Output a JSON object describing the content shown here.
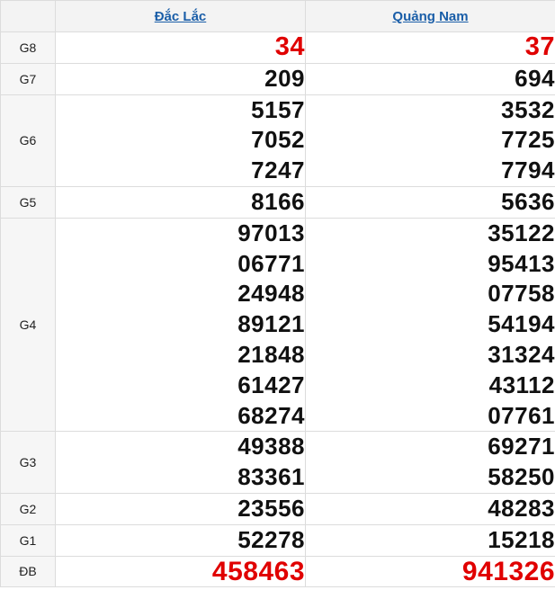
{
  "header": {
    "provinces": [
      "Đắc Lắc",
      "Quảng Nam"
    ]
  },
  "prizes": [
    {
      "label": "G8",
      "style": "red",
      "values": [
        [
          "34"
        ],
        [
          "37"
        ]
      ]
    },
    {
      "label": "G7",
      "style": "normal",
      "values": [
        [
          "209"
        ],
        [
          "694"
        ]
      ]
    },
    {
      "label": "G6",
      "style": "normal",
      "values": [
        [
          "5157",
          "7052",
          "7247"
        ],
        [
          "3532",
          "7725",
          "7794"
        ]
      ]
    },
    {
      "label": "G5",
      "style": "normal",
      "values": [
        [
          "8166"
        ],
        [
          "5636"
        ]
      ]
    },
    {
      "label": "G4",
      "style": "normal",
      "values": [
        [
          "97013",
          "06771",
          "24948",
          "89121",
          "21848",
          "61427",
          "68274"
        ],
        [
          "35122",
          "95413",
          "07758",
          "54194",
          "31324",
          "43112",
          "07761"
        ]
      ]
    },
    {
      "label": "G3",
      "style": "normal",
      "values": [
        [
          "49388",
          "83361"
        ],
        [
          "69271",
          "58250"
        ]
      ]
    },
    {
      "label": "G2",
      "style": "normal",
      "values": [
        [
          "23556"
        ],
        [
          "48283"
        ]
      ]
    },
    {
      "label": "G1",
      "style": "normal",
      "values": [
        [
          "52278"
        ],
        [
          "15218"
        ]
      ]
    },
    {
      "label": "ĐB",
      "style": "db",
      "values": [
        [
          "458463"
        ],
        [
          "941326"
        ]
      ]
    }
  ],
  "colors": {
    "link": "#1a5ea8",
    "highlight": "#e00000",
    "text": "#111111",
    "border": "#dcdcdc"
  }
}
